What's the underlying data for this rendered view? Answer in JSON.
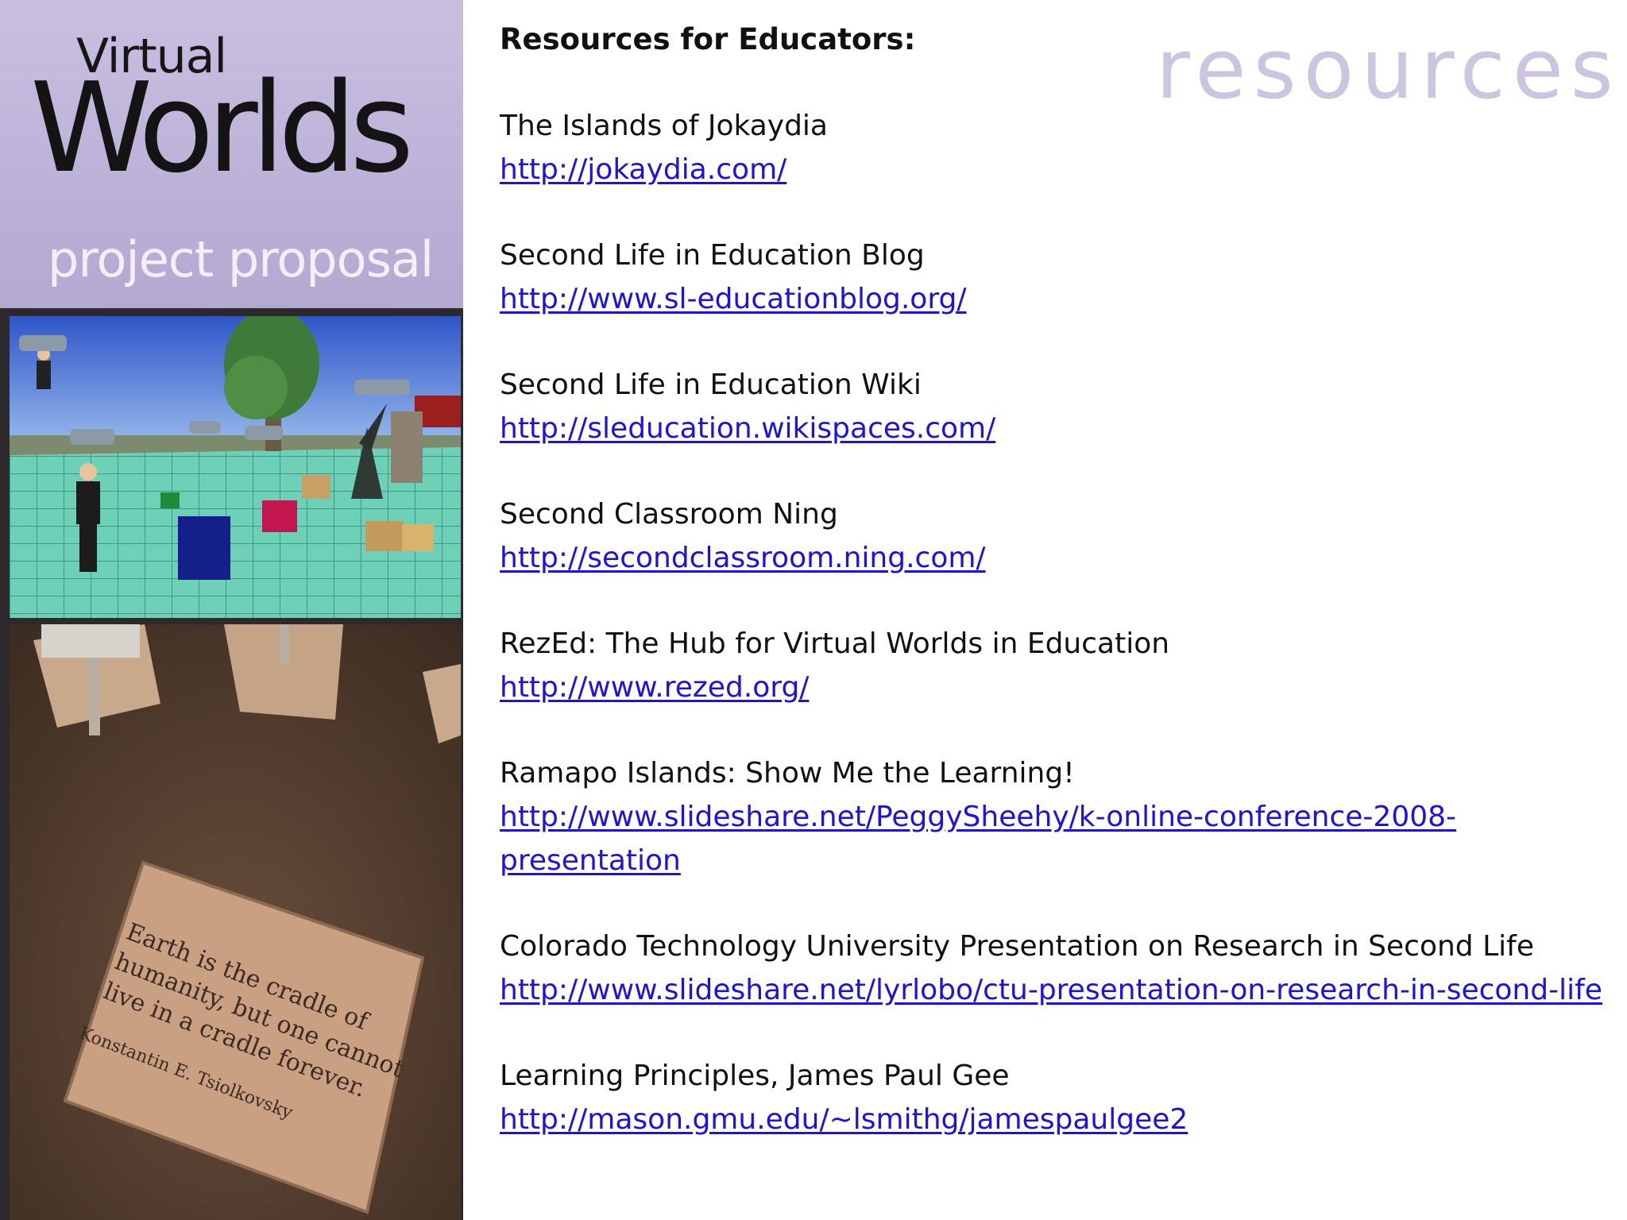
{
  "sidebar": {
    "title_small": "Virtual",
    "title_large": "Worlds",
    "subtitle": "project proposal",
    "plaque_quote": [
      "Earth is the cradle of",
      "humanity, but one cannot",
      "live in a cradle forever."
    ],
    "plaque_author": "Konstantin E. Tsiolkovsky"
  },
  "watermark": "resources",
  "heading": "Resources for Educators:",
  "resources": [
    {
      "name": "The Islands of Jokaydia",
      "url": "http://jokaydia.com/"
    },
    {
      "name": "Second Life in Education Blog",
      "url": "http://www.sl-educationblog.org/"
    },
    {
      "name": "Second Life in Education Wiki",
      "url": "http://sleducation.wikispaces.com/"
    },
    {
      "name": "Second Classroom Ning",
      "url": "http://secondclassroom.ning.com/"
    },
    {
      "name": "RezEd: The Hub for Virtual Worlds in Education",
      "url": "http://www.rezed.org/"
    },
    {
      "name": "Ramapo Islands: Show Me the Learning!",
      "url": "http://www.slideshare.net/PeggySheehy/k-online-conference-2008-presentation"
    },
    {
      "name": "Colorado Technology University Presentation on Research in Second Life",
      "url": "http://www.slideshare.net/lyrlobo/ctu-presentation-on-research-in-second-life"
    },
    {
      "name": "Learning Principles, James Paul Gee",
      "url": "http://mason.gmu.edu/~lsmithg/jamespaulgee2"
    }
  ],
  "colors": {
    "title_panel": "#bcb2d8",
    "watermark": "#cdc5e0",
    "link": "#1a12e6"
  }
}
